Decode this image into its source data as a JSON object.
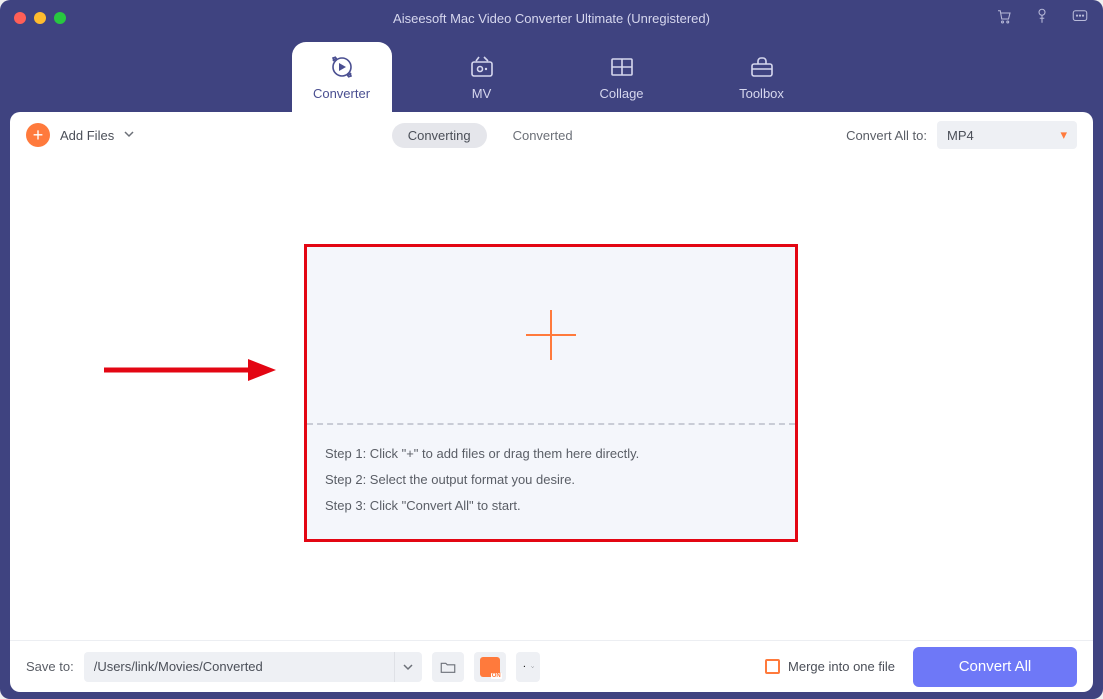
{
  "app": {
    "title": "Aiseesoft Mac Video Converter Ultimate (Unregistered)"
  },
  "colors": {
    "accent_orange": "#ff7a3c",
    "accent_purple": "#6e78f7",
    "header_bg": "#3f4380",
    "annotation_red": "#e30613"
  },
  "nav": {
    "tabs": [
      {
        "id": "converter",
        "label": "Converter",
        "active": true
      },
      {
        "id": "mv",
        "label": "MV",
        "active": false
      },
      {
        "id": "collage",
        "label": "Collage",
        "active": false
      },
      {
        "id": "toolbox",
        "label": "Toolbox",
        "active": false
      }
    ]
  },
  "toolbar": {
    "add_files_label": "Add Files",
    "segmented": {
      "converting": "Converting",
      "converted": "Converted",
      "active": "converting"
    },
    "convert_all_to_label": "Convert All to:",
    "output_format": "MP4"
  },
  "dropzone": {
    "steps": [
      "Step 1: Click \"+\" to add files or drag them here directly.",
      "Step 2: Select the output format you desire.",
      "Step 3: Click \"Convert All\" to start."
    ]
  },
  "bottom": {
    "save_to_label": "Save to:",
    "save_path": "/Users/link/Movies/Converted",
    "merge_label": "Merge into one file",
    "convert_all_button": "Convert All"
  }
}
